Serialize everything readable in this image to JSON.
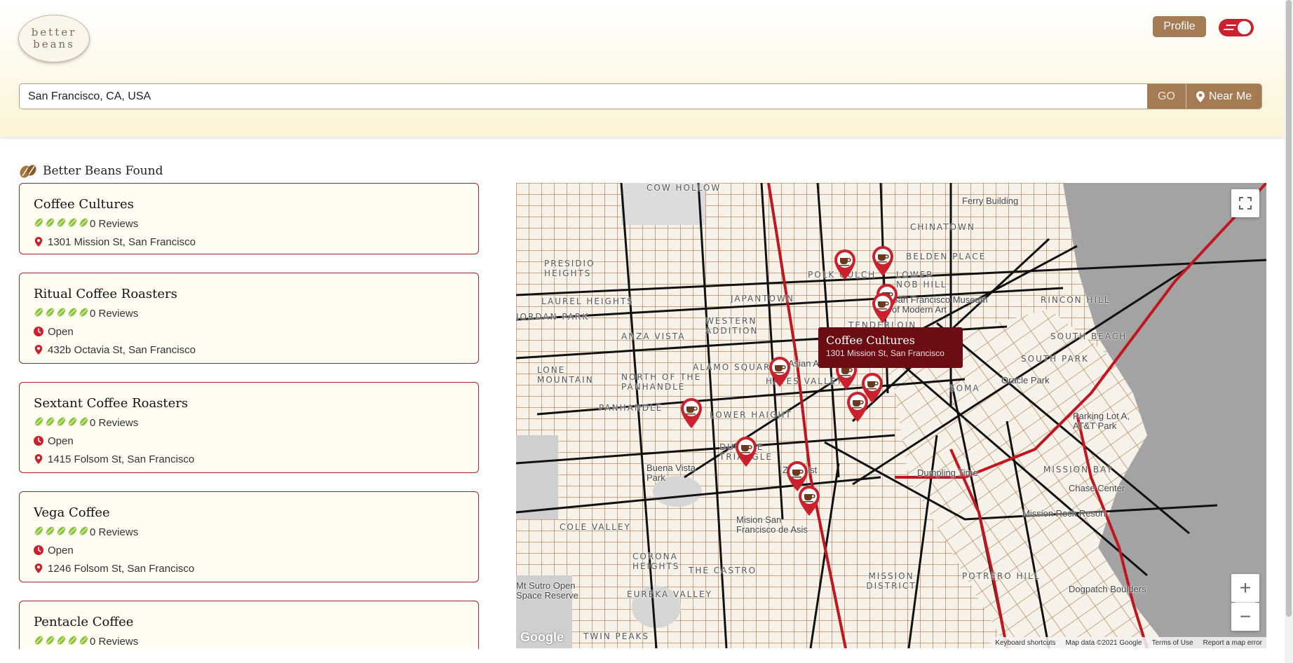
{
  "header": {
    "logo_text": "better beans",
    "profile_label": "Profile",
    "toggle_on": true
  },
  "search": {
    "value": "San Francisco, CA, USA",
    "go_label": "GO",
    "near_me_label": "Near Me"
  },
  "section": {
    "title": "Better Beans Found"
  },
  "cards": [
    {
      "name": "Coffee Cultures",
      "rating_leaves": 5,
      "reviews": "0 Reviews",
      "status": "",
      "address": "1301 Mission St, San Francisco"
    },
    {
      "name": "Ritual Coffee Roasters",
      "rating_leaves": 5,
      "reviews": "0 Reviews",
      "status": "Open",
      "address": "432b Octavia St, San Francisco"
    },
    {
      "name": "Sextant Coffee Roasters",
      "rating_leaves": 5,
      "reviews": "0 Reviews",
      "status": "Open",
      "address": "1415 Folsom St, San Francisco"
    },
    {
      "name": "Vega Coffee",
      "rating_leaves": 5,
      "reviews": "0 Reviews",
      "status": "Open",
      "address": "1246 Folsom St, San Francisco"
    },
    {
      "name": "Pentacle Coffee",
      "rating_leaves": 5,
      "reviews": "0 Reviews",
      "status": "",
      "address": ""
    }
  ],
  "map": {
    "info_window": {
      "title": "Coffee Cultures",
      "address": "1301 Mission St, San Francisco"
    },
    "neighborhoods": [
      "COW HOLLOW",
      "PRESIDIO HEIGHTS",
      "LAUREL HEIGHTS",
      "JORDAN PARK",
      "JAPANTOWN",
      "WESTERN ADDITION",
      "ANZA VISTA",
      "LONE MOUNTAIN",
      "ALAMO SQUARE",
      "NORTH OF THE PANHANDLE",
      "HAYES VALLEY",
      "PANHANDLE",
      "LOWER HAIGHT",
      "DUBOCE TRIANGLE",
      "COLE VALLEY",
      "CORONA HEIGHTS",
      "THE CASTRO",
      "EUREKA VALLEY",
      "TWIN PEAKS",
      "MISSION DISTRICT",
      "POTRERO HILL",
      "CHINATOWN",
      "POLK GULCH",
      "LOWER NOB HILL",
      "BELDEN PLACE",
      "TENDERLOIN",
      "SOMA",
      "SOUTH BEACH",
      "SOUTH PARK",
      "RINCON HILL",
      "MISSION BAY"
    ],
    "pois": [
      "Ferry Building",
      "San Francisco Museum of Modern Art",
      "Oracle Park",
      "Parking Lot A, AT&T Park",
      "Asian Art Museum",
      "Zeitgeist",
      "Dumpling Time",
      "Chase Center",
      "Mission Rock Resort",
      "Buena Vista Park",
      "Mision San Francisco de Asis",
      "Dogpatch Boulders",
      "Mt Sutro Open Space Reserve"
    ],
    "marker_count": 12,
    "google_label": "Google",
    "attribution": [
      "Keyboard shortcuts",
      "Map data ©2021 Google",
      "Terms of Use",
      "Report a map error"
    ],
    "zoom_in": "+",
    "zoom_out": "−"
  },
  "colors": {
    "brand_brown": "#a47b52",
    "accent_red": "#c9222e",
    "info_window_bg": "#6b0d12",
    "card_border": "#9b2b2b",
    "leaf_green": "#8cc63f"
  }
}
